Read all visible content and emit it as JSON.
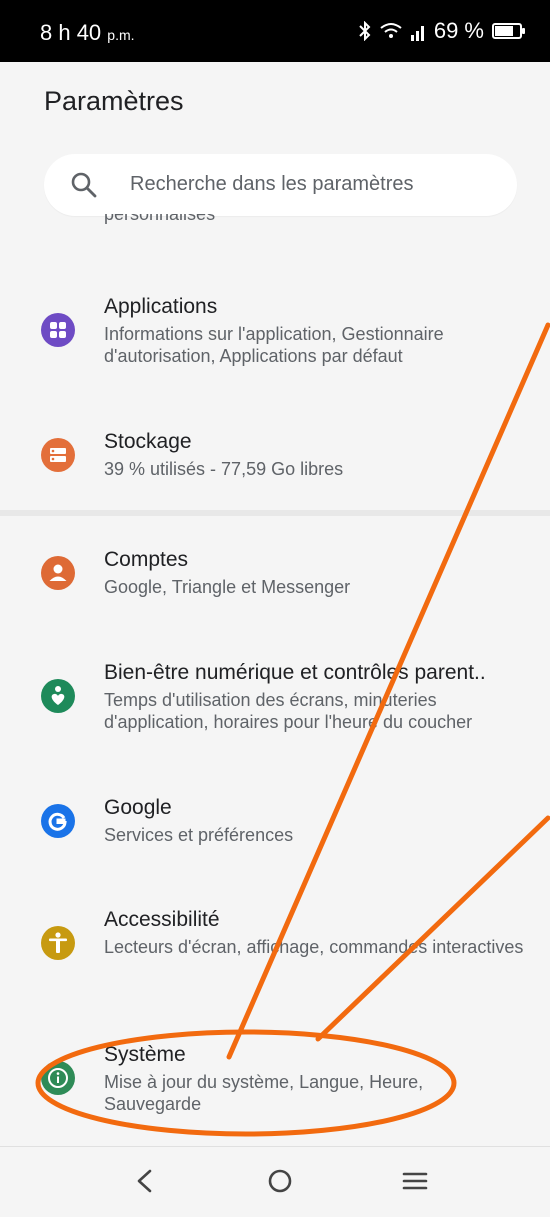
{
  "status_bar": {
    "time": "8 h 40",
    "time_suffix": "p.m.",
    "battery": "69 %",
    "battery_level": 0.69,
    "icons": [
      "bluetooth-icon",
      "wifi-icon",
      "signal-icon",
      "battery-icon"
    ]
  },
  "header": {
    "title": "Paramètres"
  },
  "search": {
    "placeholder": "Recherche dans les paramètres"
  },
  "partial_item_text": "personnalisés",
  "items": [
    {
      "title": "Applications",
      "subtitle": "Informations sur l'application, Gestionnaire d'autorisation, Applications par défaut",
      "icon": "apps-icon",
      "color": "#6e4bc4"
    },
    {
      "title": "Stockage",
      "subtitle": "39 % utilisés - 77,59 Go libres",
      "icon": "storage-icon",
      "color": "#e36f3a"
    },
    {
      "title": "Comptes",
      "subtitle": "Google, Triangle et Messenger",
      "icon": "account-icon",
      "color": "#de6a35"
    },
    {
      "title": "Bien-être numérique et contrôles parent..",
      "subtitle": "Temps d'utilisation des écrans, minuteries d'application, horaires pour l'heure du coucher",
      "icon": "wellbeing-icon",
      "color": "#1e8a5a"
    },
    {
      "title": "Google",
      "subtitle": "Services et préférences",
      "icon": "google-icon",
      "color": "#1a73e8"
    },
    {
      "title": "Accessibilité",
      "subtitle": "Lecteurs d'écran, affichage, commandes interactives",
      "icon": "accessibility-icon",
      "color": "#c79a10"
    },
    {
      "title": "Système",
      "subtitle": "Mise à jour du système, Langue, Heure, Sauvegarde",
      "icon": "info-icon",
      "color": "#2e8b57"
    }
  ],
  "nav": {
    "icons": [
      "back-icon",
      "home-icon",
      "menu-icon"
    ]
  },
  "annotation_color": "#f26a0f"
}
